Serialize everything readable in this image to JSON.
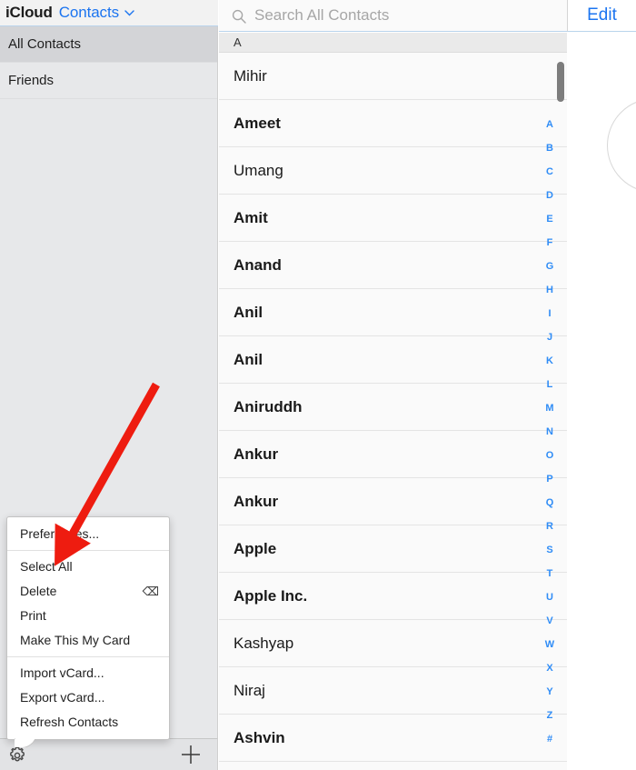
{
  "header": {
    "brand": "iCloud",
    "app_name": "Contacts",
    "chevron_icon": "chevron-down-icon"
  },
  "sidebar": {
    "groups": [
      {
        "label": "All Contacts",
        "selected": true
      },
      {
        "label": "Friends",
        "selected": false
      }
    ]
  },
  "toolbar": {
    "gear_icon": "gear-icon",
    "add_icon": "plus-icon",
    "add_label": "+"
  },
  "context_menu": {
    "sections": [
      {
        "items": [
          {
            "label": "Preferences...",
            "shortcut": ""
          }
        ]
      },
      {
        "items": [
          {
            "label": "Select All",
            "shortcut": ""
          },
          {
            "label": "Delete",
            "shortcut": "⌫"
          },
          {
            "label": "Print",
            "shortcut": ""
          },
          {
            "label": "Make This My Card",
            "shortcut": ""
          }
        ]
      },
      {
        "items": [
          {
            "label": "Import vCard...",
            "shortcut": ""
          },
          {
            "label": "Export vCard...",
            "shortcut": ""
          },
          {
            "label": "Refresh Contacts",
            "shortcut": ""
          }
        ]
      }
    ]
  },
  "search": {
    "icon": "search-icon",
    "placeholder": "Search All Contacts",
    "value": ""
  },
  "edit": {
    "label": "Edit"
  },
  "list": {
    "section_header": "A",
    "contacts": [
      {
        "name": "Mihir",
        "bold": false
      },
      {
        "name": "Ameet",
        "bold": true
      },
      {
        "name": "Umang",
        "bold": false
      },
      {
        "name": "Amit",
        "bold": true
      },
      {
        "name": "Anand",
        "bold": true
      },
      {
        "name": "Anil",
        "bold": true
      },
      {
        "name": "Anil",
        "bold": true
      },
      {
        "name": "Aniruddh",
        "bold": true
      },
      {
        "name": "Ankur",
        "bold": true
      },
      {
        "name": "Ankur",
        "bold": true
      },
      {
        "name": "Apple",
        "bold": true
      },
      {
        "name": "Apple Inc.",
        "bold": true
      },
      {
        "name": "Kashyap",
        "bold": false
      },
      {
        "name": "Niraj",
        "bold": false
      },
      {
        "name": "Ashvin",
        "bold": true
      }
    ]
  },
  "alpha_index": {
    "letters": [
      "A",
      "B",
      "C",
      "D",
      "E",
      "F",
      "G",
      "H",
      "I",
      "J",
      "K",
      "L",
      "M",
      "N",
      "O",
      "P",
      "Q",
      "R",
      "S",
      "T",
      "U",
      "V",
      "W",
      "X",
      "Y",
      "Z",
      "#"
    ]
  },
  "annotation": {
    "arrow_color": "#ee1c10",
    "points_at": "Select All"
  },
  "colors": {
    "accent_blue": "#1b74f0",
    "index_blue": "#2f8cf6",
    "sidebar_bg": "#e7e8ea",
    "selected_row": "#d3d4d7",
    "list_bg": "#fafafa"
  }
}
